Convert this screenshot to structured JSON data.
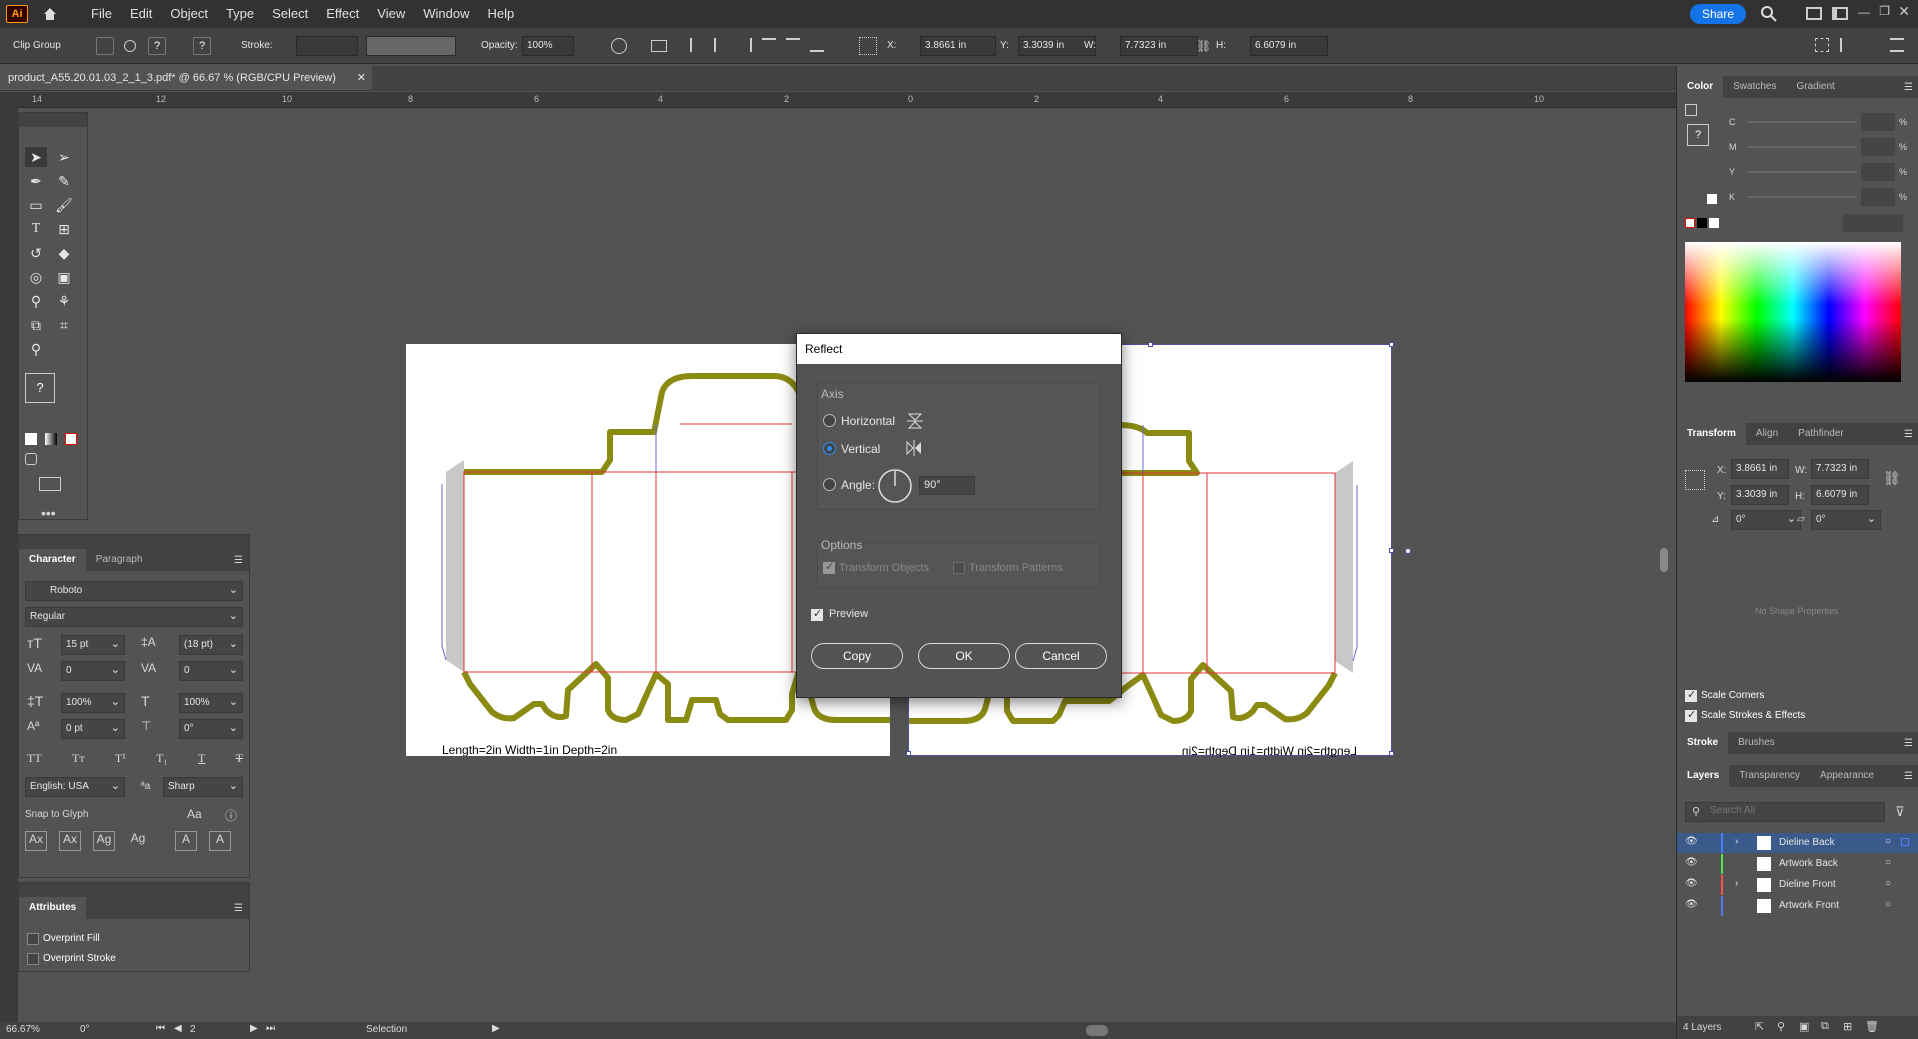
{
  "app": {
    "logo": "Ai",
    "menus": [
      "File",
      "Edit",
      "Object",
      "Type",
      "Select",
      "Effect",
      "View",
      "Window",
      "Help"
    ],
    "share_label": "Share"
  },
  "control_bar": {
    "selection_type": "Clip Group",
    "stroke_label": "Stroke:",
    "opacity_label": "Opacity:",
    "opacity_value": "100%",
    "x_label": "X:",
    "x_value": "3.8661 in",
    "y_label": "Y:",
    "y_value": "3.3039 in",
    "w_label": "W:",
    "w_value": "7.7323 in",
    "h_label": "H:",
    "h_value": "6.6079 in"
  },
  "document": {
    "tab_title": "product_A55.20.01.03_2_1_3.pdf* @ 66.67 % (RGB/CPU Preview)",
    "ruler_ticks": [
      "14",
      "12",
      "10",
      "8",
      "6",
      "4",
      "2",
      "0",
      "2",
      "4",
      "6",
      "8",
      "10"
    ],
    "artboard_caption": "Length=2in Width=1in Depth=2in",
    "artboard_caption_reflected": "Length=2in Width=1in Depth=2in"
  },
  "character_panel": {
    "tabs": [
      "Character",
      "Paragraph"
    ],
    "font_family": "Roboto",
    "font_style": "Regular",
    "font_size": "15 pt",
    "leading": "(18 pt)",
    "kerning": "0",
    "tracking": "0",
    "vertical_scale": "100%",
    "horizontal_scale": "100%",
    "baseline_shift": "0 pt",
    "rotation": "0°",
    "language": "English: USA",
    "antialias": "Sharp",
    "snap_to_glyph": "Snap to Glyph"
  },
  "attributes_panel": {
    "title": "Attributes",
    "overprint_fill": "Overprint Fill",
    "overprint_stroke": "Overprint Stroke"
  },
  "dialog": {
    "title": "Reflect",
    "axis_label": "Axis",
    "horizontal_label": "Horizontal",
    "vertical_label": "Vertical",
    "angle_label": "Angle:",
    "angle_value": "90°",
    "selected_axis": "vertical",
    "options_label": "Options",
    "transform_objects": "Transform Objects",
    "transform_patterns": "Transform Patterns",
    "preview_label": "Preview",
    "copy_label": "Copy",
    "ok_label": "OK",
    "cancel_label": "Cancel"
  },
  "color_panel": {
    "tabs": [
      "Color",
      "Swatches",
      "Gradient"
    ],
    "channels": [
      "C",
      "M",
      "Y",
      "K"
    ],
    "percent": "%"
  },
  "transform_panel": {
    "tabs": [
      "Transform",
      "Align",
      "Pathfinder"
    ],
    "x_label": "X:",
    "x_value": "3.8661 in",
    "y_label": "Y:",
    "y_value": "3.3039 in",
    "w_label": "W:",
    "w_value": "7.7323 in",
    "h_label": "H:",
    "h_value": "6.6079 in",
    "rotate_value": "0°",
    "shear_value": "0°",
    "no_shape": "No Shape Properties",
    "scale_corners": "Scale Corners",
    "scale_strokes": "Scale Strokes & Effects"
  },
  "stroke_panel": {
    "tabs": [
      "Stroke",
      "Brushes"
    ]
  },
  "layers_panel": {
    "tabs": [
      "Layers",
      "Transparency",
      "Appearance"
    ],
    "search_placeholder": "Search All",
    "layers": [
      {
        "name": "Dieline Back",
        "color": "#4f7bff",
        "expandable": true,
        "selected": true
      },
      {
        "name": "Artwork Back",
        "color": "#4fe64f",
        "expandable": false,
        "selected": false
      },
      {
        "name": "Dieline Front",
        "color": "#ff4f4f",
        "expandable": true,
        "selected": false
      },
      {
        "name": "Artwork Front",
        "color": "#4f7bff",
        "expandable": false,
        "selected": false
      }
    ],
    "count_label": "4 Layers"
  },
  "status_bar": {
    "zoom": "66.67%",
    "rotation": "0°",
    "artboard_index": "2",
    "tool": "Selection"
  },
  "colors": {
    "dieline_outline": "#8b8b14",
    "cut_line": "#e0343a",
    "guide_line": "#6a6ad0",
    "accent": "#1473e6"
  }
}
